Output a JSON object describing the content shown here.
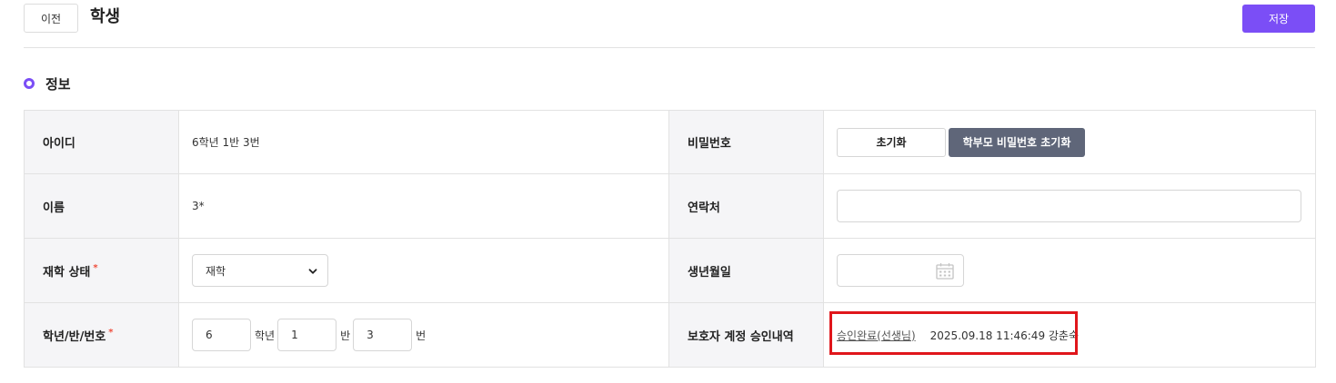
{
  "header": {
    "prev_label": "이전",
    "title": "학생",
    "save_label": "저장"
  },
  "section": {
    "title": "정보"
  },
  "fields": {
    "id": {
      "label": "아이디",
      "value": "6학년 1반 3번"
    },
    "password": {
      "label": "비밀번호",
      "reset_label": "초기화",
      "parent_reset_label": "학부모 비밀번호 초기화"
    },
    "name": {
      "label": "이름",
      "value": "3*"
    },
    "contact": {
      "label": "연락처",
      "value": ""
    },
    "status": {
      "label": "재학 상태",
      "required_mark": "*",
      "selected": "재학"
    },
    "birth": {
      "label": "생년월일",
      "value": ""
    },
    "grade": {
      "label": "학년/반/번호",
      "required_mark": "*",
      "grade_value": "6",
      "grade_unit": "학년",
      "class_value": "1",
      "class_unit": "반",
      "number_value": "3",
      "number_unit": "번"
    },
    "approval": {
      "label": "보호자 계정 승인내역",
      "link_text": "승인완료(선생님)",
      "detail": "2025.09.18 11:46:49 강춘숙"
    }
  },
  "icons": {
    "section_marker": "ring-icon",
    "select_arrow": "chevron-down-icon",
    "date_picker": "calendar-icon"
  },
  "colors": {
    "accent": "#7b4ef6",
    "secondary_button": "#5f6679",
    "required": "#ef4d3c",
    "highlight_border": "#e0161b",
    "label_cell_bg": "#f5f5f7"
  }
}
